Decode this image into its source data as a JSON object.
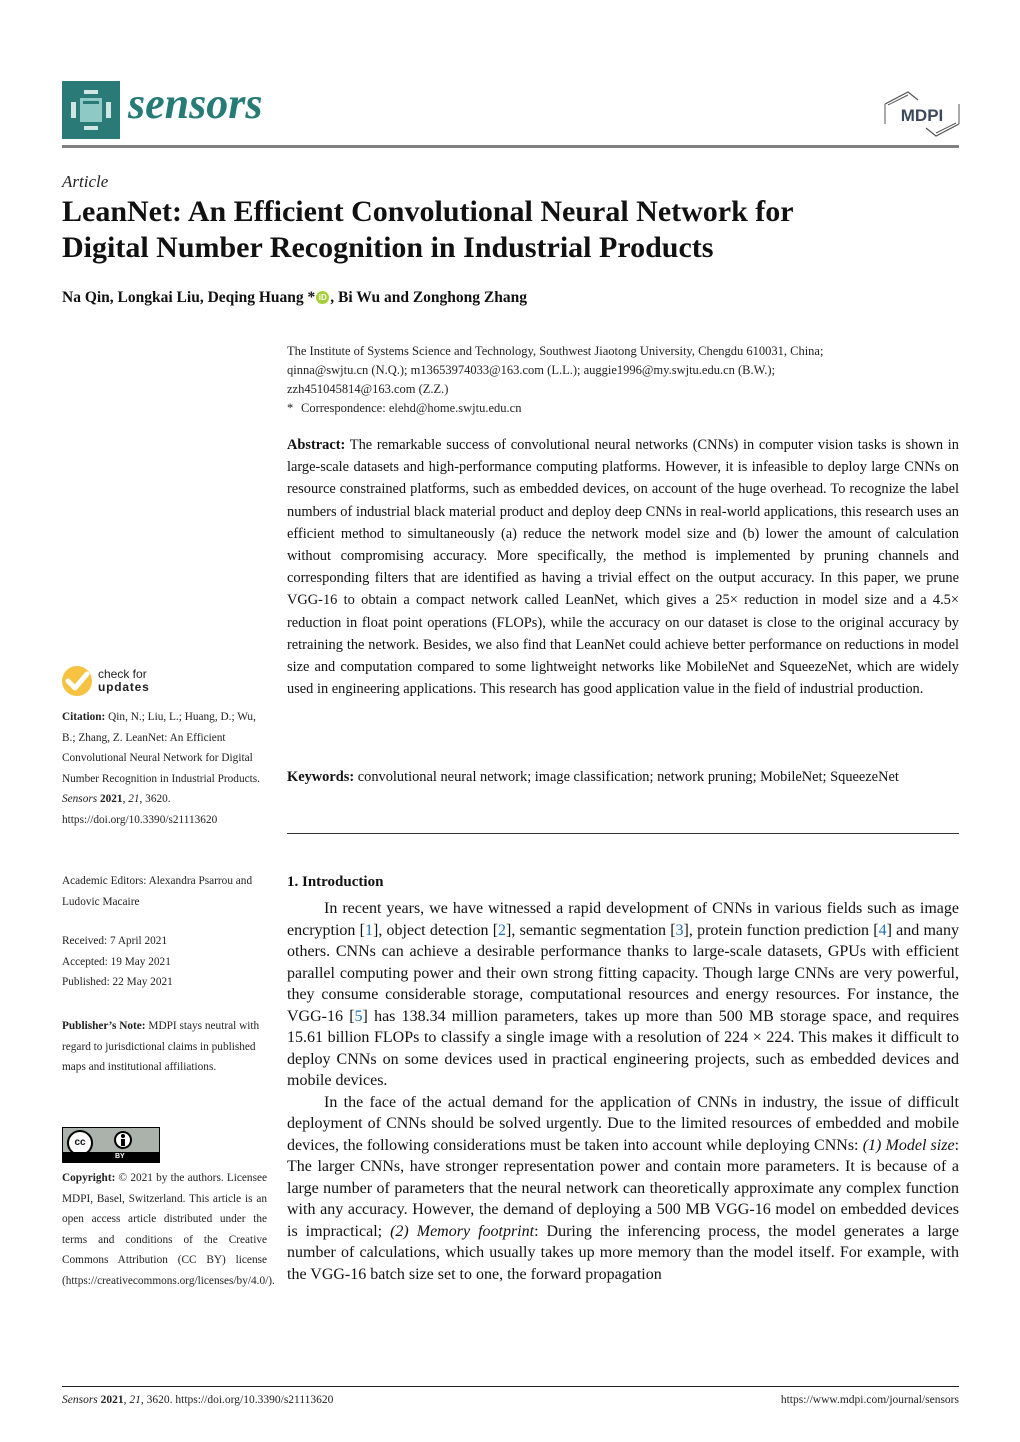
{
  "header": {
    "journal_name": "sensors",
    "publisher_logo_text": "MDPI",
    "icons": {
      "journal_logo": "sensors-chip-logo",
      "publisher_logo": "mdpi-hexagon-logo"
    },
    "colors": {
      "journal_teal": "#267b77",
      "rule_gray": "#808080"
    }
  },
  "article": {
    "type": "Article",
    "title_line1": "LeanNet: An Efficient Convolutional Neural Network for",
    "title_line2": "Digital Number Recognition in Industrial Products",
    "authors_part1": "Na Qin, Longkai Liu, Deqing Huang *",
    "orcid_label": "iD",
    "authors_part2": ", Bi Wu and Zonghong Zhang",
    "affiliation_line1": "The Institute of Systems Science and Technology, Southwest Jiaotong University, Chengdu 610031, China;",
    "affiliation_line2": "qinna@swjtu.cn (N.Q.); m13653974033@163.com (L.L.); auggie1996@my.swjtu.edu.cn (B.W.);",
    "affiliation_line3": "zzh451045814@163.com (Z.Z.)",
    "correspondence_star": "*",
    "correspondence": "Correspondence: elehd@home.swjtu.edu.cn",
    "abstract_label": "Abstract:",
    "abstract_text": " The remarkable success of convolutional neural networks (CNNs) in computer vision tasks is shown in large-scale datasets and high-performance computing platforms. However, it is infeasible to deploy large CNNs on resource constrained platforms, such as embedded devices, on account of the huge overhead. To recognize the label numbers of industrial black material product and deploy deep CNNs in real-world applications, this research uses an efficient method to simultaneously (a) reduce the network model size and (b) lower the amount of calculation without compromising accuracy. More specifically, the method is implemented by pruning channels and corresponding filters that are identified as having a trivial effect on the output accuracy. In this paper, we prune VGG-16 to obtain a compact network called LeanNet, which gives a 25× reduction in model size and a 4.5× reduction in float point operations (FLOPs), while the accuracy on our dataset is close to the original accuracy by retraining the network. Besides, we also find that LeanNet could achieve better performance on reductions in model size and computation compared to some lightweight networks like MobileNet and SqueezeNet, which are widely used in engineering applications. This research has good application value in the field of industrial production.",
    "keywords_label": "Keywords:",
    "keywords_text": "  convolutional neural network; image classification; network pruning; MobileNet; SqueezeNet"
  },
  "sidebar": {
    "check_updates_line1": "check for",
    "check_updates_line2": "updates",
    "citation_label": "Citation:",
    "citation_text1": "  Qin, N.; Liu, L.; Huang, D.; Wu, B.; Zhang, Z. LeanNet: An Efficient Convolutional Neural Network for Digital Number Recognition in Industrial Products. ",
    "citation_journal": "Sensors",
    "citation_year": " 2021",
    "citation_volume_pre": ", ",
    "citation_volume": "21",
    "citation_text2": ", 3620.  https://doi.org/10.3390/s21113620",
    "academic_editors": "Academic Editors: Alexandra Psarrou and Ludovic Macaire",
    "received": "Received: 7 April 2021",
    "accepted": "Accepted: 19 May 2021",
    "published": "Published: 22 May 2021",
    "publisher_note_label": "Publisher’s Note:",
    "publisher_note_text": " MDPI stays neutral with regard to jurisdictional claims in published maps and institutional affiliations.",
    "cc_label": "cc",
    "cc_by_label": "BY",
    "copyright_label": "Copyright:",
    "copyright_text": " © 2021 by the authors. Licensee MDPI, Basel, Switzerland. This article is an open access article distributed under the terms and conditions of the Creative Commons Attribution (CC BY) license (https://creativecommons.org/licenses/by/4.0/)."
  },
  "introduction": {
    "heading": "1. Introduction",
    "p1_a": "In recent years, we have witnessed a rapid development of CNNs in various fields such as image encryption [",
    "ref1": "1",
    "p1_b": "], object detection [",
    "ref2": "2",
    "p1_c": "], semantic segmentation [",
    "ref3": "3",
    "p1_d": "], protein function prediction [",
    "ref4": "4",
    "p1_e": "] and many others.  CNNs can achieve a desirable performance thanks to large-scale datasets, GPUs with efficient parallel computing power and their own strong fitting capacity. Though large CNNs are very powerful, they consume considerable storage, computational resources and energy resources.  For instance, the VGG-16 [",
    "ref5": "5",
    "p1_f": "] has 138.34 million parameters, takes up more than 500 MB storage space, and requires 15.61 billion FLOPs to classify a single image with a resolution of 224 × 224. This makes it difficult to deploy CNNs on some devices used in practical engineering projects, such as embedded devices and mobile devices.",
    "p2_a": "In the face of the actual demand for the application of CNNs in industry, the issue of difficult deployment of CNNs should be solved urgently. Due to the limited resources of embedded and mobile devices, the following considerations must be taken into account while deploying CNNs: ",
    "p2_em1": "(1) Model size",
    "p2_b": ": The larger CNNs, have stronger representation power and contain more parameters. It is because of a large number of parameters that the neural network can theoretically approximate any complex function with any accuracy. However, the demand of deploying a 500 MB VGG-16 model on embedded devices is impractical; ",
    "p2_em2": "(2) Memory footprint",
    "p2_c": ": During the inferencing process, the model generates a large number of calculations, which usually takes up more memory than the model itself.  For example, with the VGG-16 batch size set to one, the forward propagation",
    "ref_color": "#1f6fb5"
  },
  "footer": {
    "journal": "Sensors",
    "year": " 2021",
    "vol_pre": ", ",
    "volume": "21",
    "rest": ", 3620. https://doi.org/10.3390/s21113620",
    "url": "https://www.mdpi.com/journal/sensors"
  }
}
